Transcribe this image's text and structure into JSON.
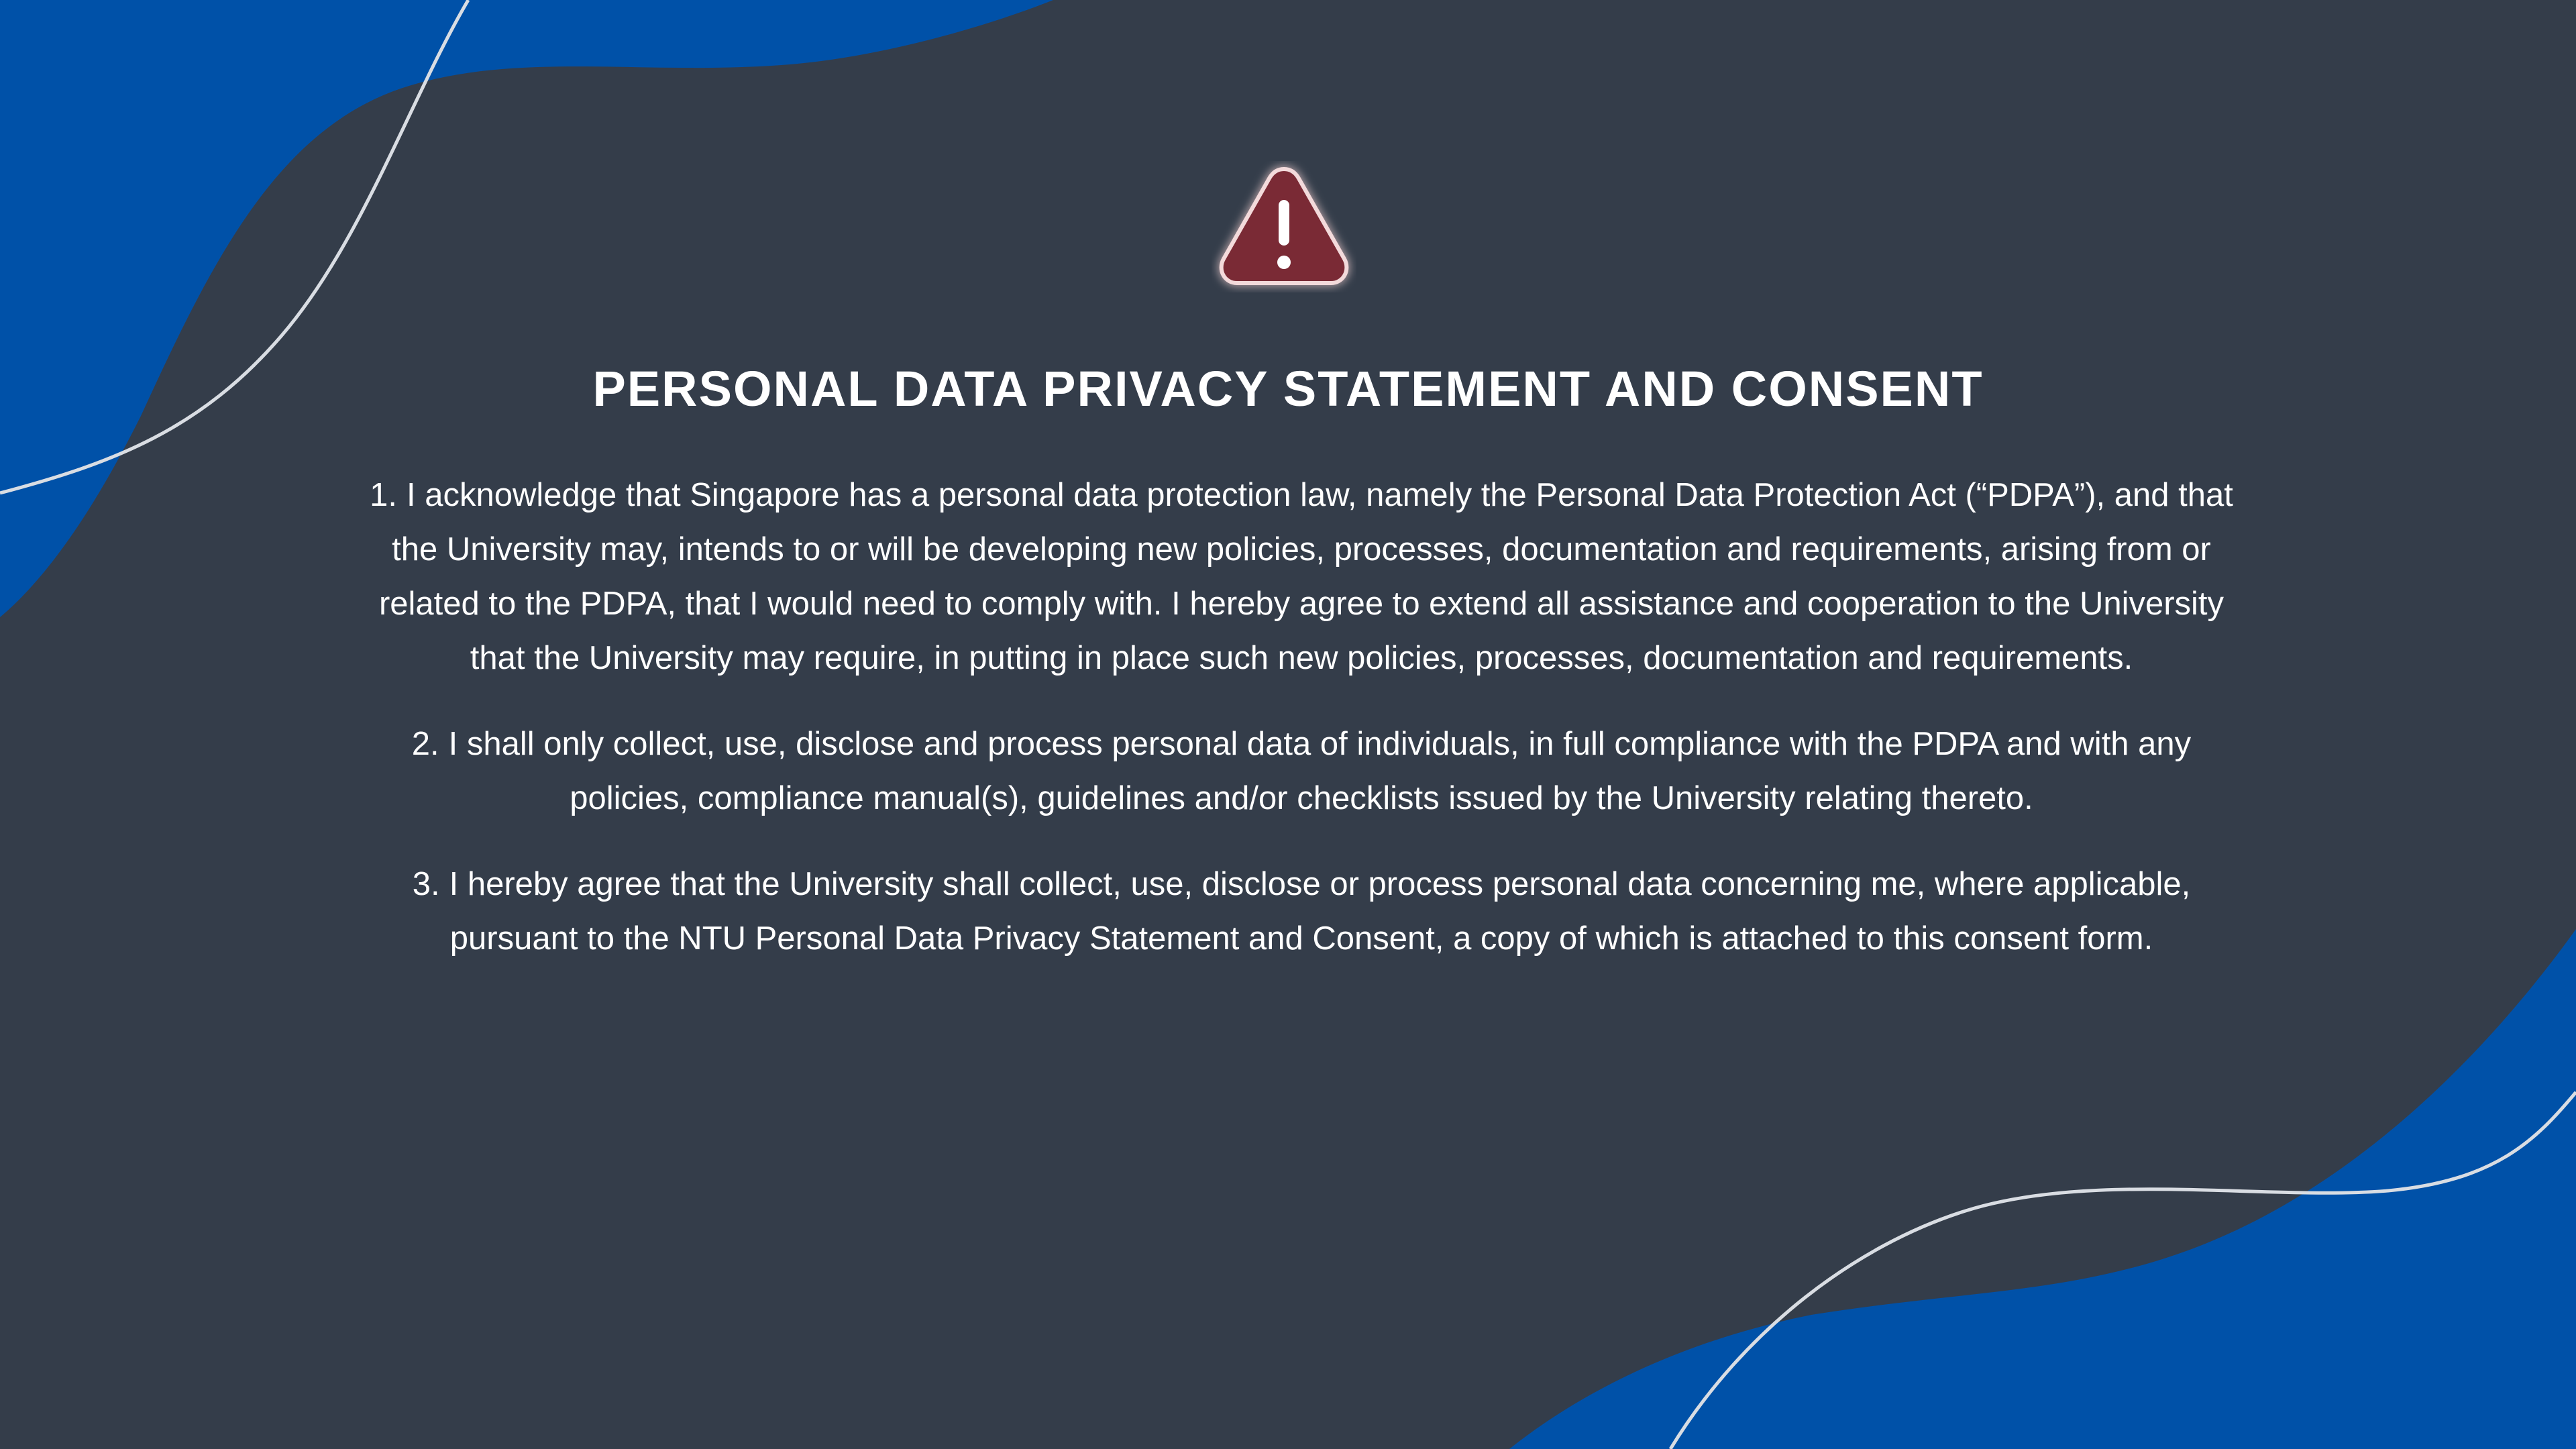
{
  "colors": {
    "background": "#343d4a",
    "accent_blue": "#0051a8",
    "wave_line": "#d9dde3",
    "warning_fill": "#7a2b35",
    "text": "#ffffff"
  },
  "icon": {
    "name": "warning-triangle-icon",
    "glyph": "!"
  },
  "title": "PERSONAL DATA PRIVACY STATEMENT AND CONSENT",
  "items": [
    {
      "number": "1.",
      "text": "I acknowledge that Singapore has a personal data protection law, namely the Personal Data Protection Act (“PDPA”), and that the University may, intends to or will be developing new policies, processes, documentation and requirements, arising from or related to the PDPA, that I would need to comply with. I hereby agree to extend all assistance and cooperation to the University that the University may require, in putting in place such new policies, processes, documentation and requirements."
    },
    {
      "number": "2.",
      "text": "I shall only collect, use, disclose and process personal data of individuals, in full compliance with the PDPA and with any policies, compliance manual(s), guidelines and/or checklists issued by the University relating thereto."
    },
    {
      "number": "3.",
      "text": "I hereby agree that the University shall collect, use, disclose or process personal data concerning me, where applicable, pursuant to the NTU Personal Data Privacy Statement and Consent, a copy of which is attached to this consent form."
    }
  ]
}
